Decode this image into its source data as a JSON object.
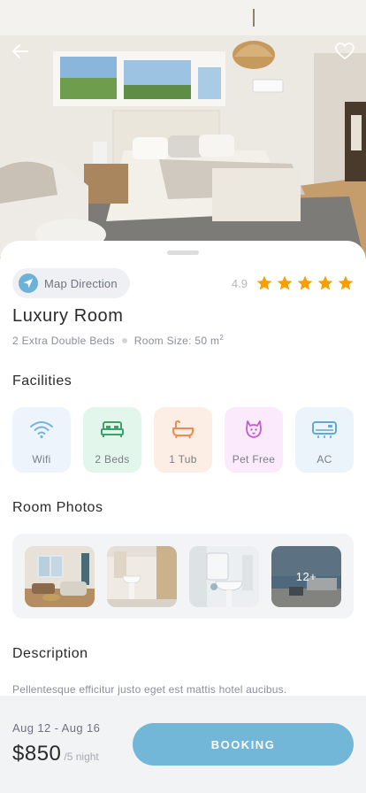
{
  "room": {
    "name": "Luxury Room",
    "beds": "2 Extra Double Beds",
    "size": "Room Size: 50 m",
    "size_unit_sup": "2",
    "rating": "4.9",
    "stars": 5
  },
  "map": {
    "label": "Map Direction"
  },
  "sections": {
    "facilities": "Facilities",
    "photos": "Room Photos",
    "description": "Description"
  },
  "facilities": [
    {
      "label": "Wifi",
      "icon": "wifi-icon",
      "bg": "#edf4fc",
      "color": "#74b2da"
    },
    {
      "label": "2 Beds",
      "icon": "bed-icon",
      "bg": "#e3f6ec",
      "color": "#3fa26a"
    },
    {
      "label": "1 Tub",
      "icon": "bathtub-icon",
      "bg": "#fdeee5",
      "color": "#ef8a55"
    },
    {
      "label": "Pet Free",
      "icon": "pet-icon",
      "bg": "#fbeafb",
      "color": "#c45ad0"
    },
    {
      "label": "AC",
      "icon": "air-conditioner-icon",
      "bg": "#ebf4fb",
      "color": "#5ea9d6"
    }
  ],
  "photos": {
    "more_label": "12+"
  },
  "description": "Pellentesque efficitur justo eget est mattis hotel aucibus.",
  "booking": {
    "dates": "Aug 12 - Aug 16",
    "price": "$850",
    "per_night": "/5 night",
    "button": "BOOKING"
  },
  "colors": {
    "accent": "#72b6d8",
    "star": "#f5a000"
  }
}
